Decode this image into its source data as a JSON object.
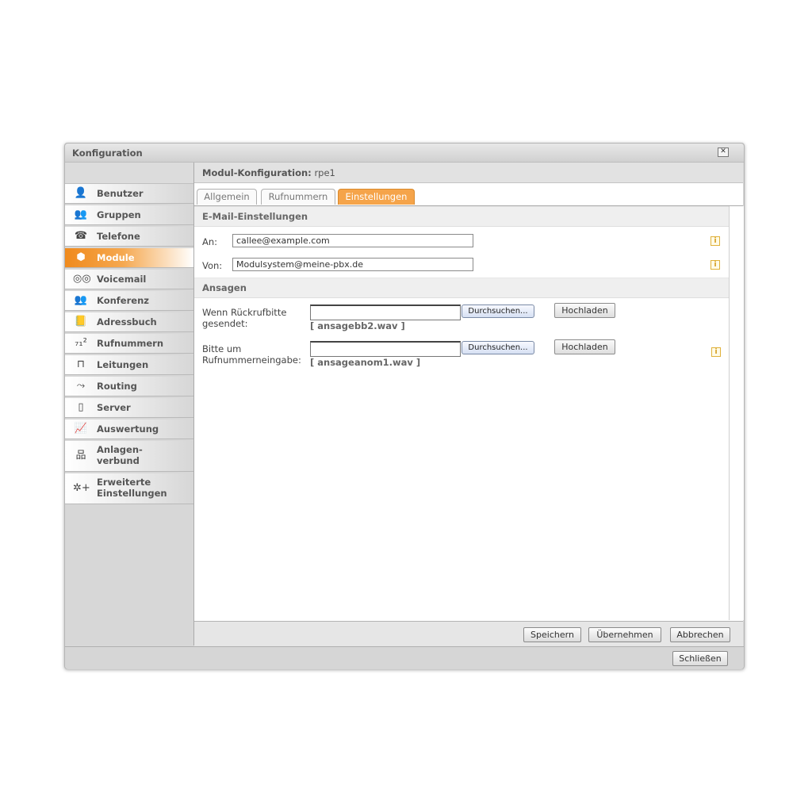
{
  "window": {
    "title": "Konfiguration",
    "close_symbol": "✕"
  },
  "sidebar": {
    "items": [
      {
        "label": "Benutzer",
        "icon": "user-icon",
        "glyph": "👤"
      },
      {
        "label": "Gruppen",
        "icon": "group-icon",
        "glyph": "👥"
      },
      {
        "label": "Telefone",
        "icon": "phone-icon",
        "glyph": "☎"
      },
      {
        "label": "Module",
        "icon": "module-box-icon",
        "glyph": "⬢"
      },
      {
        "label": "Voicemail",
        "icon": "voicemail-icon",
        "glyph": "◎◎"
      },
      {
        "label": "Konferenz",
        "icon": "conference-icon",
        "glyph": "👥"
      },
      {
        "label": "Adressbuch",
        "icon": "addressbook-icon",
        "glyph": "📒"
      },
      {
        "label": "Rufnummern",
        "icon": "numbers-icon",
        "glyph": "₇₁²"
      },
      {
        "label": "Leitungen",
        "icon": "lines-icon",
        "glyph": "⊓"
      },
      {
        "label": "Routing",
        "icon": "routing-icon",
        "glyph": "⤳"
      },
      {
        "label": "Server",
        "icon": "server-icon",
        "glyph": "▯"
      },
      {
        "label": "Auswertung",
        "icon": "chart-icon",
        "glyph": "📈"
      },
      {
        "label": "Anlagen-\nverbund",
        "icon": "network-icon",
        "glyph": "品"
      },
      {
        "label": "Erweiterte\nEinstellungen",
        "icon": "advanced-settings-icon",
        "glyph": "✲+"
      }
    ],
    "active": "Module"
  },
  "module_header": {
    "label": "Modul-Konfiguration:",
    "value": "rpe1"
  },
  "tabs": [
    "Allgemein",
    "Rufnummern",
    "Einstellungen"
  ],
  "active_tab": "Einstellungen",
  "email_section": {
    "title": "E-Mail-Einstellungen",
    "to_label": "An:",
    "to_value": "callee@example.com",
    "from_label": "Von:",
    "from_value": "Modulsystem@meine-pbx.de"
  },
  "announcements": {
    "title": "Ansagen",
    "rows": [
      {
        "label": "Wenn Rückrufbitte\ngesendet:",
        "browse": "Durchsuchen...",
        "upload": "Hochladen",
        "file": "[ ansagebb2.wav ]"
      },
      {
        "label": "Bitte um\nRufnummerneingabe:",
        "browse": "Durchsuchen...",
        "upload": "Hochladen",
        "file": "[ ansageanom1.wav ]"
      }
    ]
  },
  "info_symbol": "i",
  "footer": {
    "save": "Speichern",
    "apply": "Übernehmen",
    "cancel": "Abbrechen"
  },
  "bottom": {
    "close": "Schließen"
  }
}
